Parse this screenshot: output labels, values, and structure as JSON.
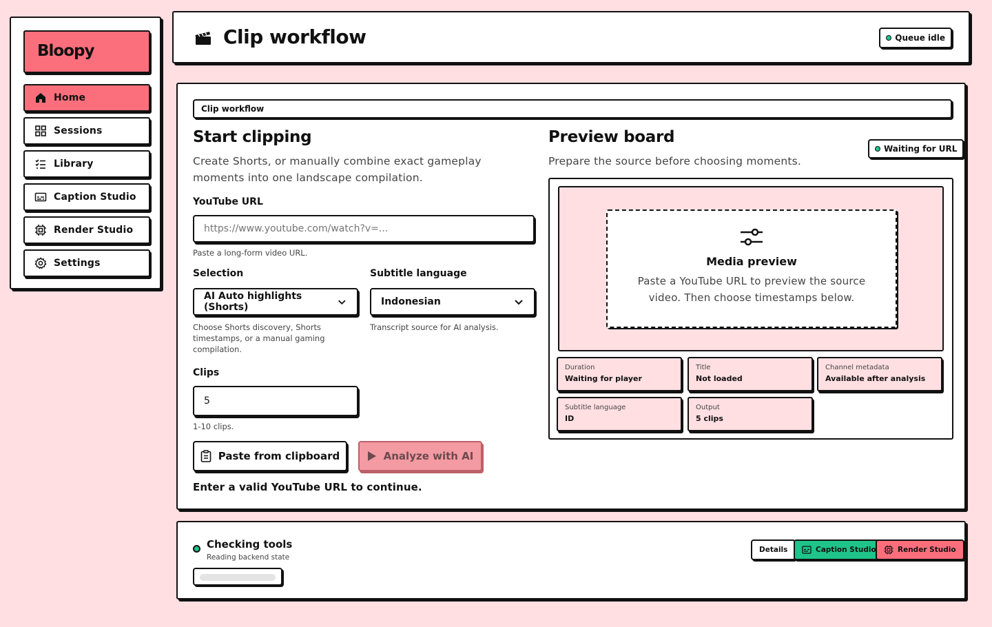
{
  "app": {
    "brand": "Bloopy"
  },
  "sidebar": {
    "items": [
      {
        "label": "Home",
        "icon": "home-icon",
        "active": true
      },
      {
        "label": "Sessions",
        "icon": "grid-icon"
      },
      {
        "label": "Library",
        "icon": "list-check-icon"
      },
      {
        "label": "Caption Studio",
        "icon": "caption-icon"
      },
      {
        "label": "Render Studio",
        "icon": "chip-icon"
      },
      {
        "label": "Settings",
        "icon": "gear-icon"
      }
    ]
  },
  "header": {
    "title": "Clip workflow",
    "icon": "clapperboard-icon",
    "queue_status": "Queue idle"
  },
  "main": {
    "breadcrumb": "Clip workflow",
    "start": {
      "title": "Start clipping",
      "description": "Create Shorts, or manually combine exact gameplay moments into one landscape compilation.",
      "url_label": "YouTube URL",
      "url_placeholder": "https://www.youtube.com/watch?v=...",
      "url_value": "",
      "url_hint": "Paste a long-form video URL.",
      "selection_label": "Selection",
      "selection_value": "AI Auto highlights (Shorts)",
      "selection_hint": "Choose Shorts discovery, Shorts timestamps, or a manual gaming compilation.",
      "subtitle_label": "Subtitle language",
      "subtitle_value": "Indonesian",
      "subtitle_hint": "Transcript source for AI analysis.",
      "clips_label": "Clips",
      "clips_value": "5",
      "clips_hint": "1-10 clips.",
      "paste_button": "Paste from clipboard",
      "analyze_button": "Analyze with AI",
      "validation": "Enter a valid YouTube URL to continue."
    },
    "preview": {
      "title": "Preview board",
      "description": "Prepare the source before choosing moments.",
      "status": "Waiting for URL",
      "media_title": "Media preview",
      "media_text": "Paste a YouTube URL to preview the source video. Then choose timestamps below.",
      "meta": [
        {
          "key": "Duration",
          "value": "Waiting for player"
        },
        {
          "key": "Title",
          "value": "Not loaded"
        },
        {
          "key": "Channel metadata",
          "value": "Available after analysis"
        },
        {
          "key": "Subtitle language",
          "value": "ID"
        },
        {
          "key": "Output",
          "value": "5 clips"
        }
      ]
    }
  },
  "status_bar": {
    "title": "Checking tools",
    "subtitle": "Reading backend state",
    "details_button": "Details",
    "caption_button": "Caption Studio",
    "render_button": "Render Studio",
    "colors": {
      "ok": "#1ec48a",
      "accent": "#fb6f7c"
    }
  }
}
